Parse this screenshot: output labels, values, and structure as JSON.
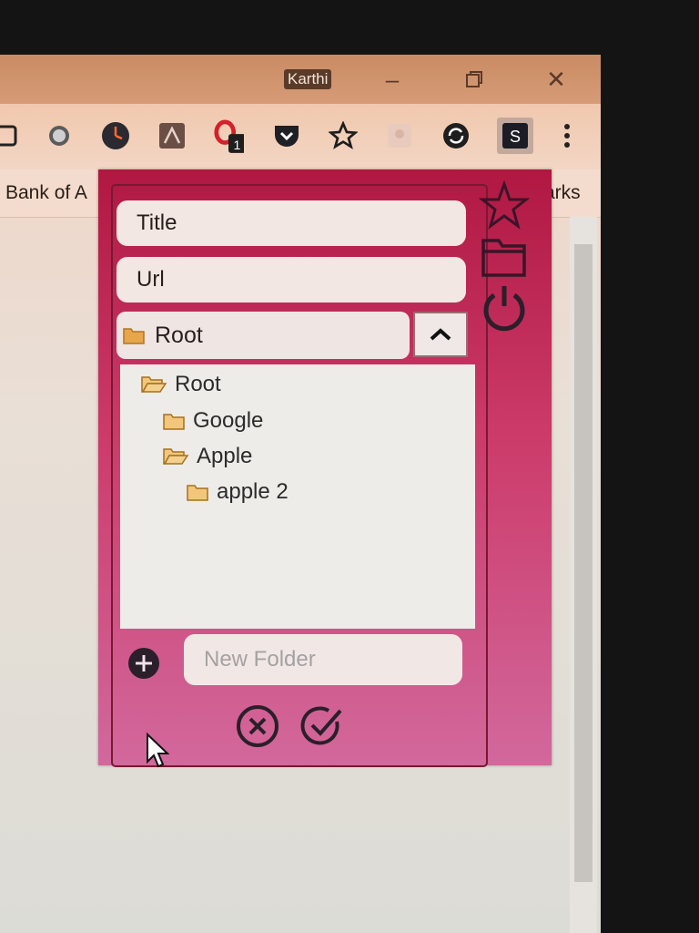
{
  "browser": {
    "profile_name": "Karthi",
    "window_controls": [
      "minimize-icon",
      "restore-icon",
      "close-icon"
    ],
    "extension_badge": "1",
    "bookmarks": {
      "left_text": "Bank of A",
      "right_text": "arks"
    }
  },
  "popup": {
    "title_field": {
      "value": "Title"
    },
    "url_field": {
      "value": "Url"
    },
    "folder_select": {
      "selected": "Root"
    },
    "tree": [
      {
        "label": "Root",
        "level": 0,
        "open": true
      },
      {
        "label": "Google",
        "level": 1,
        "open": false
      },
      {
        "label": "Apple",
        "level": 1,
        "open": true
      },
      {
        "label": "apple 2",
        "level": 2,
        "open": false
      }
    ],
    "new_folder": {
      "placeholder": "New Folder"
    },
    "side_icons": [
      "star-icon",
      "folder-icon",
      "power-icon"
    ],
    "actions": [
      "cancel-icon",
      "confirm-icon"
    ]
  },
  "colors": {
    "popup_top": "#b01842",
    "popup_bottom": "#d2689c",
    "icon_dark": "#2a1f2a"
  }
}
